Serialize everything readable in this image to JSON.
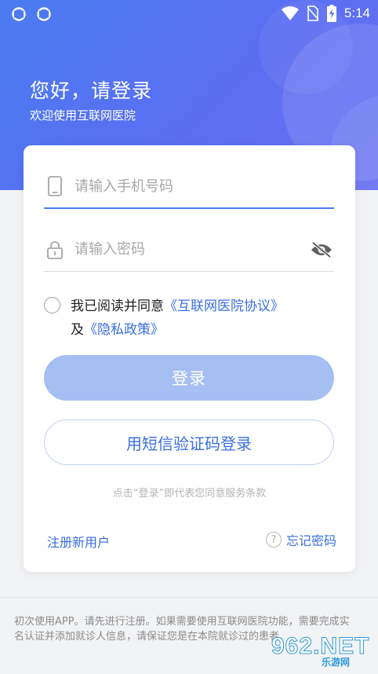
{
  "status_bar": {
    "time": "5:14",
    "icons": [
      "sync-icon",
      "sync-icon",
      "wifi-icon",
      "no-sim-icon",
      "battery-charging-icon"
    ]
  },
  "header": {
    "greeting": "您好，请登录",
    "welcome": "欢迎使用互联网医院"
  },
  "form": {
    "phone_placeholder": "请输入手机号码",
    "password_placeholder": "请输入密码",
    "agree_prefix": "我已阅读并同意",
    "agree_link1": "《互联网医院协议》",
    "agree_and": "及",
    "agree_link2": "《隐私政策》",
    "login_label": "登录",
    "sms_login_label": "用短信验证码登录",
    "terms_hint": "点击“登录”即代表您同意服务条款",
    "register_label": "注册新用户",
    "forgot_label": "忘记密码",
    "forgot_icon_glyph": "?"
  },
  "footer": {
    "notice": "初次使用APP。请先进行注册。如果需要使用互联网医院功能，需要完成实名认证并添加就诊人信息，请保证您是在本院就诊过的患者"
  },
  "watermark": {
    "number": "962",
    "suffix": ".NET",
    "site": "乐游网"
  },
  "colors": {
    "accent": "#4a7cf0",
    "link": "#3a6fe0",
    "login_button_disabled": "#a6bff2"
  }
}
